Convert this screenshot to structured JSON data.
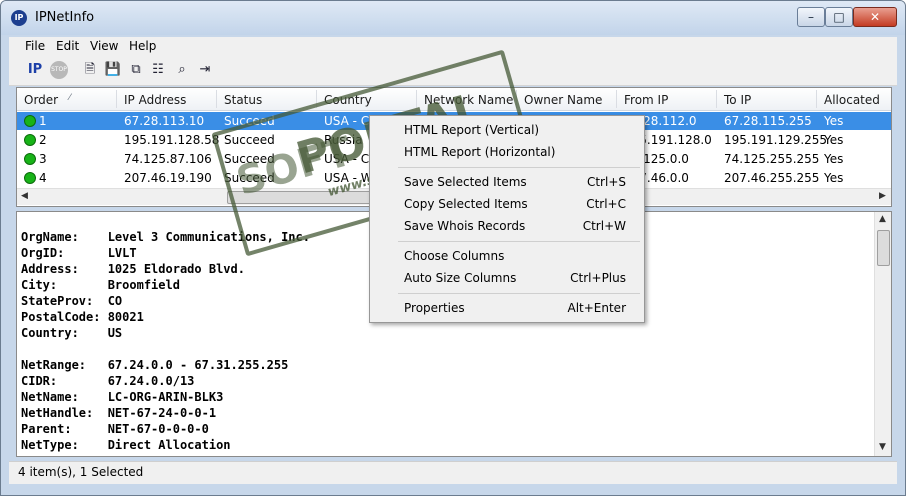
{
  "window": {
    "title": "IPNetInfo",
    "app_icon": "IP"
  },
  "window_buttons": {
    "minimize": "–",
    "maximize": "□",
    "close": "✕"
  },
  "menu": [
    "File",
    "Edit",
    "View",
    "Help"
  ],
  "toolbar": {
    "ip_label": "IP",
    "stop_label": "STOP",
    "icons": [
      "ip-icon",
      "stop-icon",
      "document-icon",
      "save-icon",
      "copy-icon",
      "properties-icon",
      "find-icon",
      "exit-icon"
    ]
  },
  "columns": [
    "Order",
    "IP Address",
    "Status",
    "Country",
    "Network Name",
    "Owner Name",
    "From IP",
    "To IP",
    "Allocated"
  ],
  "rows": [
    {
      "order": "1",
      "ip": "67.28.113.10",
      "status": "Succeed",
      "country": "USA - Ca",
      "network": "",
      "owner": "",
      "from": "67.28.112.0",
      "to": "67.28.115.255",
      "allocated": "Yes",
      "selected": true
    },
    {
      "order": "2",
      "ip": "195.191.128.58",
      "status": "Succeed",
      "country": "Russia",
      "network": "",
      "owner": "",
      "from": "195.191.128.0",
      "to": "195.191.129.255",
      "allocated": "Yes",
      "selected": false
    },
    {
      "order": "3",
      "ip": "74.125.87.106",
      "status": "Succeed",
      "country": "USA - Ca",
      "network": "",
      "owner": "",
      "from": "74.125.0.0",
      "to": "74.125.255.255",
      "allocated": "Yes",
      "selected": false
    },
    {
      "order": "4",
      "ip": "207.46.19.190",
      "status": "Succeed",
      "country": "USA - W",
      "network": "",
      "owner": "",
      "from": "207.46.0.0",
      "to": "207.46.255.255",
      "allocated": "Yes",
      "selected": false
    }
  ],
  "whois": [
    "OrgName:    Level 3 Communications, Inc.",
    "OrgID:      LVLT",
    "Address:    1025 Eldorado Blvd.",
    "City:       Broomfield",
    "StateProv:  CO",
    "PostalCode: 80021",
    "Country:    US",
    "",
    "NetRange:   67.24.0.0 - 67.31.255.255",
    "CIDR:       67.24.0.0/13",
    "NetName:    LC-ORG-ARIN-BLK3",
    "NetHandle:  NET-67-24-0-0-1",
    "Parent:     NET-67-0-0-0-0",
    "NetType:    Direct Allocation"
  ],
  "status_bar": "4 item(s), 1 Selected",
  "context_menu": [
    {
      "label": "HTML Report (Vertical)",
      "shortcut": ""
    },
    {
      "label": "HTML Report (Horizontal)",
      "shortcut": ""
    },
    {
      "separator": true
    },
    {
      "label": "Save Selected Items",
      "shortcut": "Ctrl+S"
    },
    {
      "label": "Copy Selected Items",
      "shortcut": "Ctrl+C"
    },
    {
      "label": "Save Whois Records",
      "shortcut": "Ctrl+W"
    },
    {
      "separator": true
    },
    {
      "label": "Choose Columns",
      "shortcut": ""
    },
    {
      "label": "Auto Size Columns",
      "shortcut": "Ctrl+Plus"
    },
    {
      "separator": true
    },
    {
      "label": "Properties",
      "shortcut": "Alt+Enter"
    }
  ],
  "watermark": {
    "soft": "SOFT",
    "big": "PORTAL",
    "small": "www.softportal.com"
  }
}
